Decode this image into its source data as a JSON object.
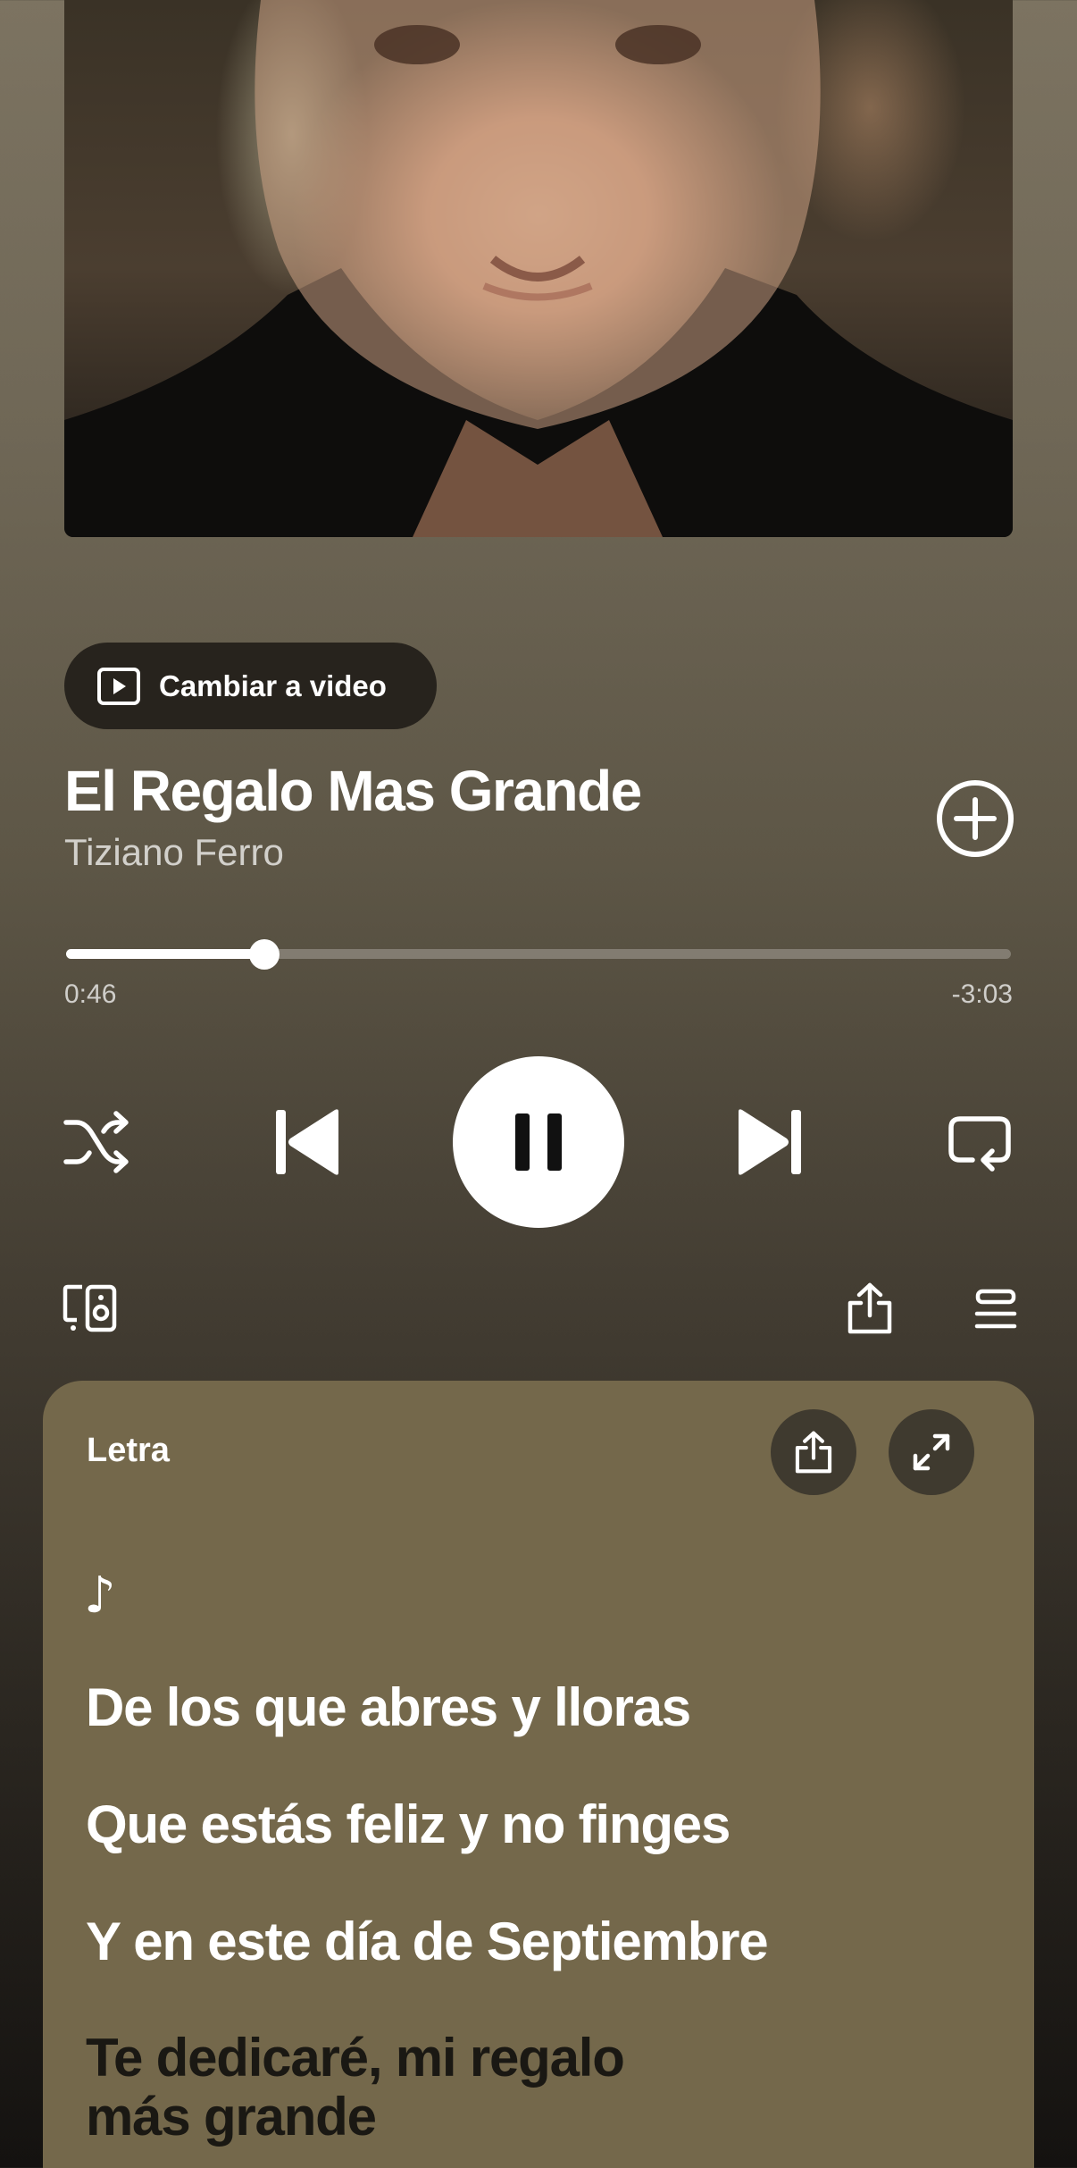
{
  "artwork": {
    "alt": "Tiziano Ferro portrait"
  },
  "video_toggle": {
    "label": "Cambiar a video",
    "icon": "play-video-icon"
  },
  "track": {
    "title": "El Regalo Mas Grande",
    "artist": "Tiziano Ferro"
  },
  "playback": {
    "elapsed": "0:46",
    "remaining": "-3:03",
    "progress_fraction": 0.21
  },
  "controls": {
    "shuffle_icon": "shuffle-icon",
    "previous_icon": "skip-previous-icon",
    "play_pause_icon": "pause-icon",
    "next_icon": "skip-next-icon",
    "repeat_icon": "repeat-icon"
  },
  "toolbar": {
    "devices_icon": "devices-icon",
    "share_icon": "share-icon",
    "queue_icon": "queue-icon"
  },
  "lyrics": {
    "label": "Letra",
    "note": "♪",
    "lines": [
      "De los que abres y lloras",
      "Que estás feliz y no finges",
      "Y en este día de Septiembre",
      "Te dedicaré, mi regalo más grande"
    ]
  },
  "colors": {
    "lyrics_card": "#74684b",
    "current_lyric": "#1a1813",
    "pill": "#27231d"
  }
}
